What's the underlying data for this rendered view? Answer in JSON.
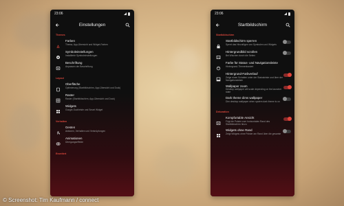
{
  "left_phone": {
    "status": {
      "time": "23:06"
    },
    "appbar": {
      "title": "Einstellungen",
      "back_icon": "back-arrow-icon",
      "search_icon": "search-icon"
    },
    "sections": [
      {
        "title": "Themes",
        "items": [
          {
            "title": "Farben",
            "subtitle": "Thema, App-Übersicht und Widget-Farben",
            "icon": "palette-icon"
          },
          {
            "title": "Symboleinstellungen",
            "subtitle": "Installierte Symboleinstellungen",
            "icon": "settings-icon"
          },
          {
            "title": "Beschriftung",
            "subtitle": "Anpassen der Beschriftung",
            "icon": "label-icon"
          }
        ]
      },
      {
        "title": "Layout",
        "items": [
          {
            "title": "Oberfläche",
            "subtitle": "Optimierung (Startbildschirm, App-Übersicht und Dock)",
            "icon": "surface-icon"
          },
          {
            "title": "Raster",
            "subtitle": "Raster (Startbildschirm, App-Übersicht und Dock)",
            "icon": "grid-icon"
          },
          {
            "title": "Widgets",
            "subtitle": "Google-Suchleiste und Smart Widget",
            "icon": "widgets-icon"
          }
        ]
      },
      {
        "title": "Verhalten",
        "items": [
          {
            "title": "Gesten",
            "subtitle": "Aktionen, Verhalten und Verknüpfungen",
            "icon": "gesture-icon"
          },
          {
            "title": "Animationen",
            "subtitle": "Übergangseffekte",
            "icon": "animation-icon"
          }
        ]
      },
      {
        "title": "Erweitert",
        "items": []
      }
    ]
  },
  "right_phone": {
    "status": {
      "time": "23:06"
    },
    "appbar": {
      "title": "Startbildschirm",
      "back_icon": "back-arrow-icon",
      "search_icon": "search-icon"
    },
    "sections": [
      {
        "title": "Startbildschirm",
        "items": [
          {
            "title": "Startbildschirm sperren",
            "subtitle": "Sperrt das Hinzufügen von Symbolen und Widgets",
            "icon": "lock-icon",
            "toggle": false
          },
          {
            "title": "Hintergrundbild scrollen",
            "subtitle": "Bei Wischen durch die Seiten",
            "icon": "wallpaper-icon",
            "toggle": false
          },
          {
            "title": "Farbe für Status- und Navigationsleiste",
            "subtitle": "Hintergrund-Themenbasiert",
            "icon": "palette-icon",
            "toggle": null
          },
          {
            "title": "Hintergrund-Farbverlauf",
            "subtitle": "Zeige einen Schatten unter der Statusleiste und über der Navigationsleiste",
            "icon": "gradient-icon",
            "toggle": true
          },
          {
            "title": "Wallpaper zoom",
            "subtitle": "Desktop wallpaper will scale depending on the launcher state",
            "icon": null,
            "toggle": true
          },
          {
            "title": "Dark theme dims wallpaper",
            "subtitle": "Dim desktop wallpaper when system dark theme is on",
            "icon": null,
            "toggle": false
          }
        ]
      },
      {
        "title": "Dekoration",
        "items": [
          {
            "title": "Kompfortable Ansicht",
            "subtitle": "Fügt die Polster zum horizontalen Rand des Startbildschirm hinzu",
            "icon": "comfort-icon",
            "toggle": true
          },
          {
            "title": "Widgets ohne Rand",
            "subtitle": "Zeigt Widgets ohne Polster am Rand über die gesamte",
            "icon": "widgets-icon",
            "toggle": false
          }
        ]
      }
    ]
  },
  "credit": "© Screenshot: Tim Kaufmann / connect",
  "colors": {
    "accent": "#d9473c",
    "phone_bg": "#0f0f0f",
    "toggle_on": "#e3453a"
  }
}
